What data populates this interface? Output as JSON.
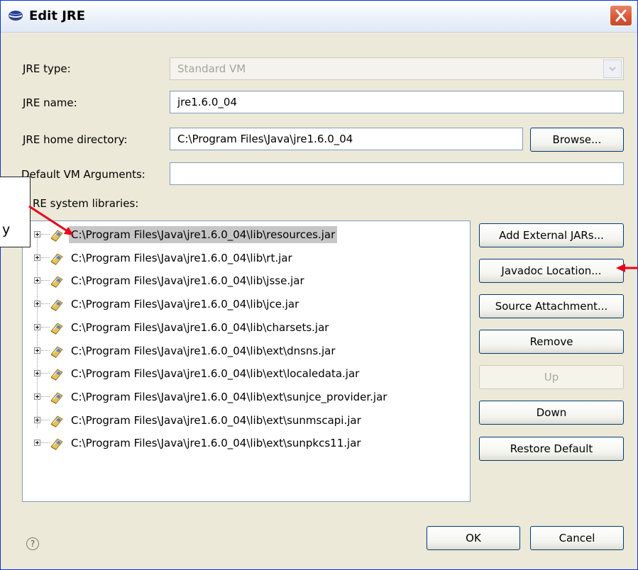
{
  "window": {
    "title": "Edit JRE"
  },
  "form": {
    "jre_type_label": "JRE type:",
    "jre_type_value": "Standard VM",
    "jre_name_label": "JRE name:",
    "jre_name_value": "jre1.6.0_04",
    "home_label": "JRE home directory:",
    "home_value": "C:\\Program Files\\Java\\jre1.6.0_04",
    "browse_label": "Browse...",
    "vm_args_label": "Default VM Arguments:",
    "vm_args_value": "",
    "libraries_label": "RE system libraries:"
  },
  "libraries": [
    {
      "path": "C:\\Program Files\\Java\\jre1.6.0_04\\lib\\resources.jar",
      "selected": true
    },
    {
      "path": "C:\\Program Files\\Java\\jre1.6.0_04\\lib\\rt.jar",
      "selected": false
    },
    {
      "path": "C:\\Program Files\\Java\\jre1.6.0_04\\lib\\jsse.jar",
      "selected": false
    },
    {
      "path": "C:\\Program Files\\Java\\jre1.6.0_04\\lib\\jce.jar",
      "selected": false
    },
    {
      "path": "C:\\Program Files\\Java\\jre1.6.0_04\\lib\\charsets.jar",
      "selected": false
    },
    {
      "path": "C:\\Program Files\\Java\\jre1.6.0_04\\lib\\ext\\dnsns.jar",
      "selected": false
    },
    {
      "path": "C:\\Program Files\\Java\\jre1.6.0_04\\lib\\ext\\localedata.jar",
      "selected": false
    },
    {
      "path": "C:\\Program Files\\Java\\jre1.6.0_04\\lib\\ext\\sunjce_provider.jar",
      "selected": false
    },
    {
      "path": "C:\\Program Files\\Java\\jre1.6.0_04\\lib\\ext\\sunmscapi.jar",
      "selected": false
    },
    {
      "path": "C:\\Program Files\\Java\\jre1.6.0_04\\lib\\ext\\sunpkcs11.jar",
      "selected": false
    }
  ],
  "side_buttons": {
    "add_external_jars": "Add External JARs...",
    "javadoc_location": "Javadoc Location...",
    "source_attachment": "Source Attachment...",
    "remove": "Remove",
    "up": "Up",
    "down": "Down",
    "restore_default": "Restore Default"
  },
  "footer": {
    "ok": "OK",
    "cancel": "Cancel"
  },
  "callout": {
    "text": "y"
  },
  "colors": {
    "annotation_arrow": "#e8001c",
    "title_close": "#d9583a",
    "selection": "#c6c6c6"
  },
  "icons": {
    "title": "java-cup-icon",
    "close": "close-icon",
    "jar": "jar-icon",
    "help": "help-icon"
  }
}
